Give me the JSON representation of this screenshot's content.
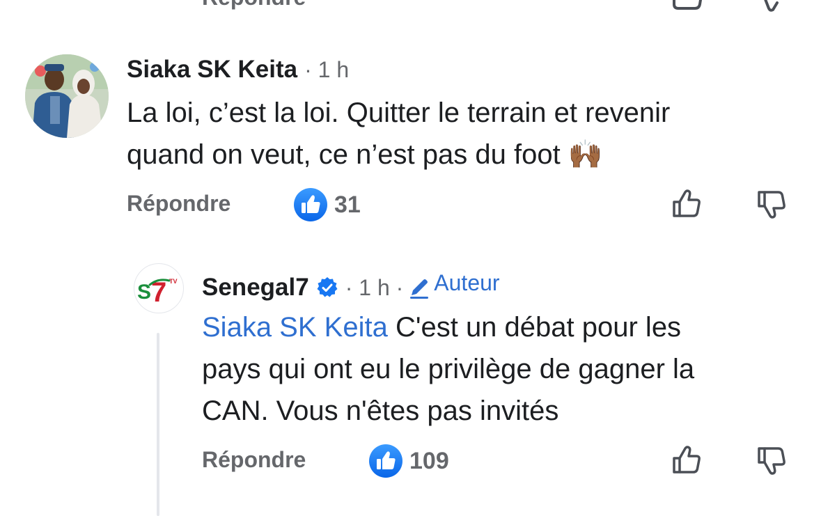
{
  "previous_comment": {
    "reply_label": "Répondre"
  },
  "comment": {
    "author": "Siaka SK Keita",
    "meta": "· 1 h",
    "text_line1": "La loi, c’est la loi. Quitter le terrain et revenir",
    "text_line2": "quand on veut, ce n’est pas du foot",
    "emoji": "🙌🏾",
    "reply_label": "Répondre",
    "like_count": "31"
  },
  "reply": {
    "author": "Senegal7",
    "meta": "· 1 h ·",
    "badge_label": "Auteur",
    "mention": "Siaka SK Keita",
    "text_line1": " C'est un débat pour les",
    "text_line2": "pays qui ont eu le privilège de gagner la",
    "text_line3": "CAN. Vous n'êtes pas invités",
    "reply_label": "Répondre",
    "like_count": "109",
    "avatar_logo_text": "S7",
    "avatar_logo_suffix": "TV"
  },
  "colors": {
    "accent": "#1877f2",
    "mention": "#2f6fd0",
    "secondary_text": "#65676b",
    "primary_text": "#1c1e21",
    "logo_red": "#d0202e",
    "logo_green": "#1a8f3c"
  },
  "icons": {
    "like": "thumbs-up-icon",
    "dislike": "thumbs-down-icon",
    "verified": "verified-badge-icon",
    "pencil": "pencil-icon"
  }
}
